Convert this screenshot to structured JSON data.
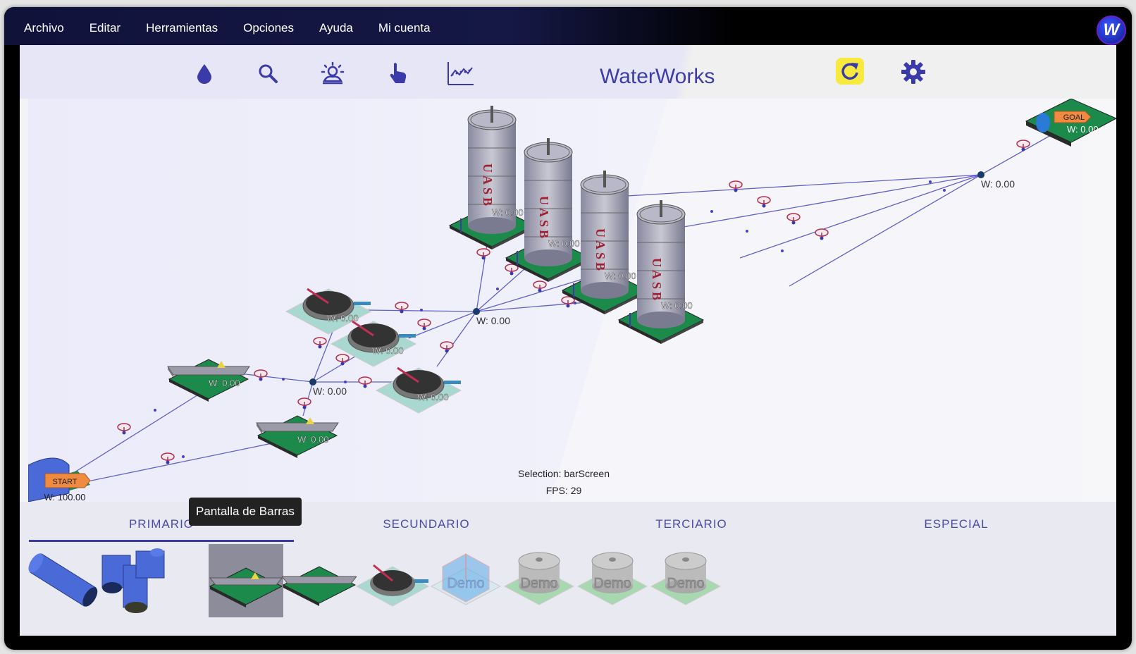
{
  "menu": {
    "items": [
      "Archivo",
      "Editar",
      "Herramientas",
      "Opciones",
      "Ayuda",
      "Mi cuenta"
    ]
  },
  "logo": {
    "letter": "W",
    "icon": "waterworks-logo-icon"
  },
  "toolbar": {
    "icons": [
      "water-drop-icon",
      "search-icon",
      "weather-icon",
      "pointer-hand-icon",
      "chart-icon"
    ],
    "app_title": "WaterWorks",
    "refresh_icon": "refresh-icon",
    "settings_icon": "gear-icon",
    "accent": "#3d3da8",
    "refresh_bg": "#f7e93e"
  },
  "scene": {
    "start_label": "START",
    "goal_label": "GOAL",
    "start_flow": "W: 100.00",
    "flow_label": "W: 0.00",
    "uasb_text": "UASB",
    "junction_labels": [
      "W: 0.00",
      "W: 0.00",
      "W: 0.00"
    ]
  },
  "status": {
    "selection": "Selection: barScreen",
    "fps": "FPS: 29"
  },
  "tabs": {
    "items": [
      "PRIMARIO",
      "SECUNDARIO",
      "TERCIARIO",
      "ESPECIAL"
    ],
    "active": "PRIMARIO",
    "tooltip": "Pantalla de Barras"
  },
  "palette": {
    "demo_label": "Demo",
    "items": [
      "pipe",
      "tee-pipe",
      "bar-screen",
      "grit-chamber",
      "clarifier",
      "demo-tank",
      "demo-uasb-1",
      "demo-uasb-2",
      "demo-uasb-3"
    ]
  }
}
